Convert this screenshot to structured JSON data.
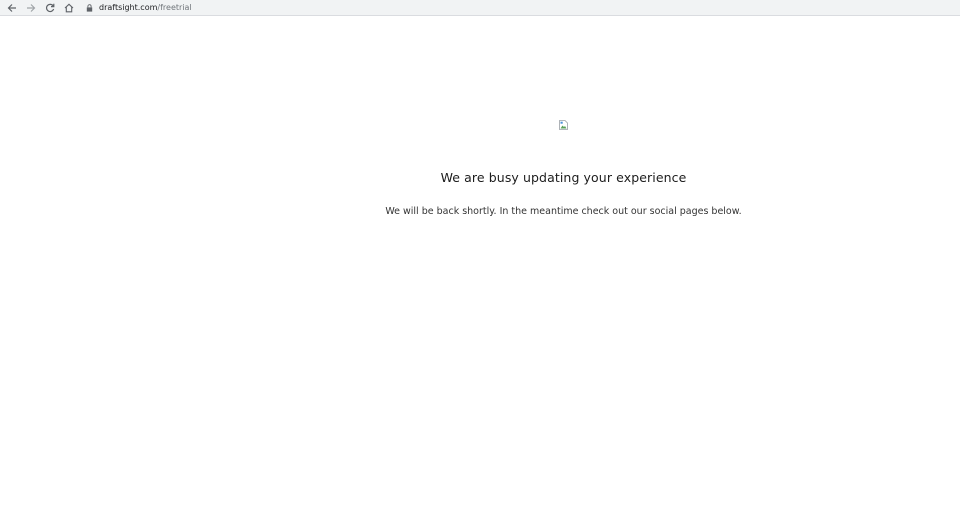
{
  "browser": {
    "url_domain": "draftsight.com",
    "url_path": "/freetrial",
    "icons": [
      "back-arrow-icon",
      "forward-arrow-icon",
      "reload-icon",
      "home-icon",
      "lock-icon"
    ]
  },
  "page": {
    "headline": "We are busy updating your experience",
    "message": "We will be back shortly. In the meantime check out our social pages below.",
    "image": "broken-image-icon"
  }
}
